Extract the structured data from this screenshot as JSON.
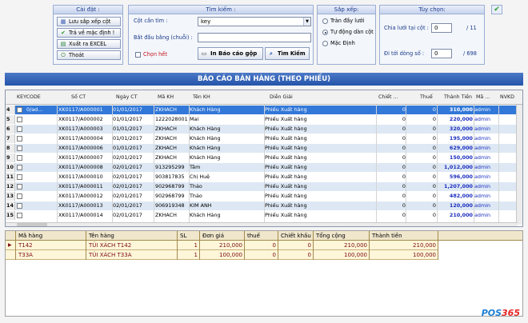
{
  "settings": {
    "title": "Cài đặt :",
    "save_columns_label": "Lưu sắp xếp cột",
    "reset_label": "Trả về mặc định !",
    "export_label": "Xuất ra EXCEL",
    "exit_label": "Thoát"
  },
  "search": {
    "title": "Tìm kiếm :",
    "column_label": "Cột cần tìm :",
    "column_value": "key",
    "starts_with_label": "Bắt đầu bằng (chuỗi) :",
    "starts_with_value": "",
    "select_all_label": "Chọn hết",
    "print_label": "In Báo cáo gộp",
    "find_label": "Tìm Kiếm"
  },
  "sort": {
    "title": "Sắp xếp:",
    "options": [
      "Tràn đầy lưới",
      "Tự động dàn cột",
      "Mặc Định"
    ],
    "selected": "Tự động dàn cột"
  },
  "options": {
    "title": "Tùy chọn:",
    "split_label": "Chia lưới tại cột :",
    "split_value": "0",
    "split_total": "/ 11",
    "goto_label": "Đi tới dòng số :",
    "goto_value": "0",
    "goto_total": "/ 698"
  },
  "report_title": "BÁO CÁO BÁN HÀNG (THEO PHIẾU)",
  "grid": {
    "columns": [
      "KEYCODE",
      "Số CT",
      "Ngày CT",
      "Mã KH",
      "Tên KH",
      "Diễn Giải",
      "Chiết ...",
      "Thuế",
      "Thành Tiền",
      "Mã ...",
      "NVKD"
    ],
    "rows": [
      {
        "idx": "4",
        "key": "0/ad...",
        "so_ct": "XK0117/A000001",
        "ngay": "01/01/2017",
        "ma_kh": "ZKHACH",
        "ten_kh": "Khách Hàng",
        "dien_giai": "Phiếu Xuất hàng",
        "chiet": "0",
        "thue": "0",
        "thanh_tien": "310,000",
        "ma": "admin",
        "nvkd": ""
      },
      {
        "idx": "5",
        "key": "",
        "so_ct": "XK0117/A000002",
        "ngay": "01/01/2017",
        "ma_kh": "1222028001",
        "ten_kh": "Mai",
        "dien_giai": "Phiếu Xuất hàng",
        "chiet": "0",
        "thue": "0",
        "thanh_tien": "220,000",
        "ma": "admin",
        "nvkd": ""
      },
      {
        "idx": "6",
        "key": "",
        "so_ct": "XK0117/A000003",
        "ngay": "01/01/2017",
        "ma_kh": "ZKHACH",
        "ten_kh": "Khách Hàng",
        "dien_giai": "Phiếu Xuất hàng",
        "chiet": "0",
        "thue": "0",
        "thanh_tien": "320,000",
        "ma": "admin",
        "nvkd": ""
      },
      {
        "idx": "7",
        "key": "",
        "so_ct": "XK0117/A000004",
        "ngay": "01/01/2017",
        "ma_kh": "ZKHACH",
        "ten_kh": "Khách Hàng",
        "dien_giai": "Phiếu Xuất hàng",
        "chiet": "0",
        "thue": "0",
        "thanh_tien": "195,000",
        "ma": "admin",
        "nvkd": ""
      },
      {
        "idx": "8",
        "key": "",
        "so_ct": "XK0117/A000006",
        "ngay": "01/01/2017",
        "ma_kh": "ZKHACH",
        "ten_kh": "Khách Hàng",
        "dien_giai": "Phiếu Xuất hàng",
        "chiet": "0",
        "thue": "0",
        "thanh_tien": "629,000",
        "ma": "admin",
        "nvkd": ""
      },
      {
        "idx": "9",
        "key": "",
        "so_ct": "XK0117/A000007",
        "ngay": "02/01/2017",
        "ma_kh": "ZKHACH",
        "ten_kh": "Khách Hàng",
        "dien_giai": "Phiếu Xuất hàng",
        "chiet": "0",
        "thue": "0",
        "thanh_tien": "150,000",
        "ma": "admin",
        "nvkd": ""
      },
      {
        "idx": "10",
        "key": "",
        "so_ct": "XK0117/A000008",
        "ngay": "02/01/2017",
        "ma_kh": "913295299",
        "ten_kh": "Tâm",
        "dien_giai": "Phiếu Xuất hàng",
        "chiet": "0",
        "thue": "0",
        "thanh_tien": "1,012,000",
        "ma": "admin",
        "nvkd": ""
      },
      {
        "idx": "11",
        "key": "",
        "so_ct": "XK0117/A000010",
        "ngay": "02/01/2017",
        "ma_kh": "903817835",
        "ten_kh": "Chị Huệ",
        "dien_giai": "Phiếu Xuất hàng",
        "chiet": "0",
        "thue": "0",
        "thanh_tien": "596,000",
        "ma": "admin",
        "nvkd": ""
      },
      {
        "idx": "12",
        "key": "",
        "so_ct": "XK0117/A000011",
        "ngay": "02/01/2017",
        "ma_kh": "902968799",
        "ten_kh": "Thảo",
        "dien_giai": "Phiếu Xuất hàng",
        "chiet": "0",
        "thue": "0",
        "thanh_tien": "1,207,000",
        "ma": "admin",
        "nvkd": ""
      },
      {
        "idx": "13",
        "key": "",
        "so_ct": "XK0117/A000012",
        "ngay": "02/01/2017",
        "ma_kh": "902968799",
        "ten_kh": "Thảo",
        "dien_giai": "Phiếu Xuất hàng",
        "chiet": "0",
        "thue": "0",
        "thanh_tien": "482,000",
        "ma": "admin",
        "nvkd": ""
      },
      {
        "idx": "14",
        "key": "",
        "so_ct": "XK0117/A000013",
        "ngay": "02/01/2017",
        "ma_kh": "906919348",
        "ten_kh": "KIM ANH",
        "dien_giai": "Phiếu Xuất hàng",
        "chiet": "0",
        "thue": "0",
        "thanh_tien": "120,000",
        "ma": "admin",
        "nvkd": ""
      },
      {
        "idx": "15",
        "key": "",
        "so_ct": "XK0117/A000014",
        "ngay": "02/01/2017",
        "ma_kh": "ZKHACH",
        "ten_kh": "Khách Hàng",
        "dien_giai": "Phiếu Xuất hàng",
        "chiet": "0",
        "thue": "0",
        "thanh_tien": "210,000",
        "ma": "admin",
        "nvkd": ""
      }
    ]
  },
  "detail": {
    "columns": [
      "Mã hàng",
      "Tên hàng",
      "SL",
      "Đơn giá",
      "thuế",
      "Chiết khấu",
      "Tổng cộng",
      "Thành tiền"
    ],
    "rows": [
      {
        "ma": "T142",
        "ten": "TÚI XÁCH T142",
        "sl": "1",
        "don_gia": "210,000",
        "thue": "0",
        "chiet_khau": "0",
        "tong": "210,000",
        "thanh_tien": "210,000"
      },
      {
        "ma": "T33A",
        "ten": "TÚI XÁCH T33A",
        "sl": "1",
        "don_gia": "100,000",
        "thue": "0",
        "chiet_khau": "0",
        "tong": "100,000",
        "thanh_tien": "100,000"
      }
    ]
  },
  "brand": {
    "logo_text": "POS",
    "logo_number": "365"
  }
}
